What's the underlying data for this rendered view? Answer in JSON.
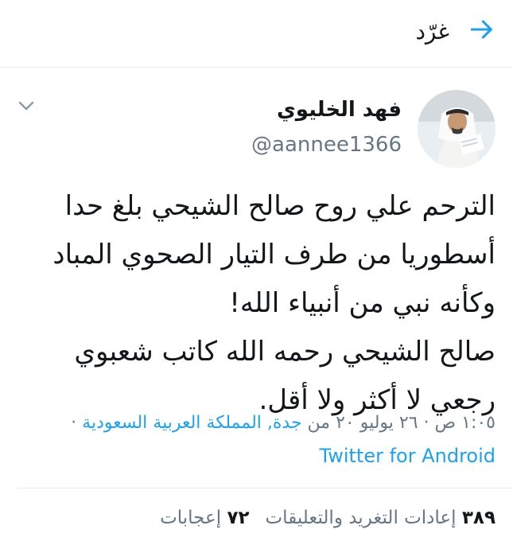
{
  "header": {
    "title": "غرّد",
    "back_icon": "arrow-right-icon"
  },
  "tweet": {
    "display_name": "فهد الخليوي",
    "handle": "@aannee1366",
    "menu_icon": "chevron-down-icon",
    "lines": [
      "الترحم علي روح صالح الشيحي  بلغ حدا",
      "أسطوريا من طرف  التيار الصحوي المباد",
      "وكأنه نبي من أنبياء الله!",
      "صالح الشيحي رحمه الله كاتب شعبوي",
      "رجعي لا أكثر ولا أقل."
    ],
    "meta": {
      "time_date": "١:٠٥ ص · ٢٦ يوليو ٢٠ من",
      "location": "جدة, المملكة العربية السعودية",
      "dot": "·"
    },
    "source": "Twitter for Android",
    "stats": {
      "retweets_count": "٣٨٩",
      "retweets_label": "إعادات التغريد والتعليقات",
      "likes_count": "٧٢",
      "likes_label": "إعجابات"
    }
  },
  "colors": {
    "accent": "#1da1f2",
    "text": "#14171a",
    "secondary": "#657786",
    "divider": "#e6ecf0"
  }
}
